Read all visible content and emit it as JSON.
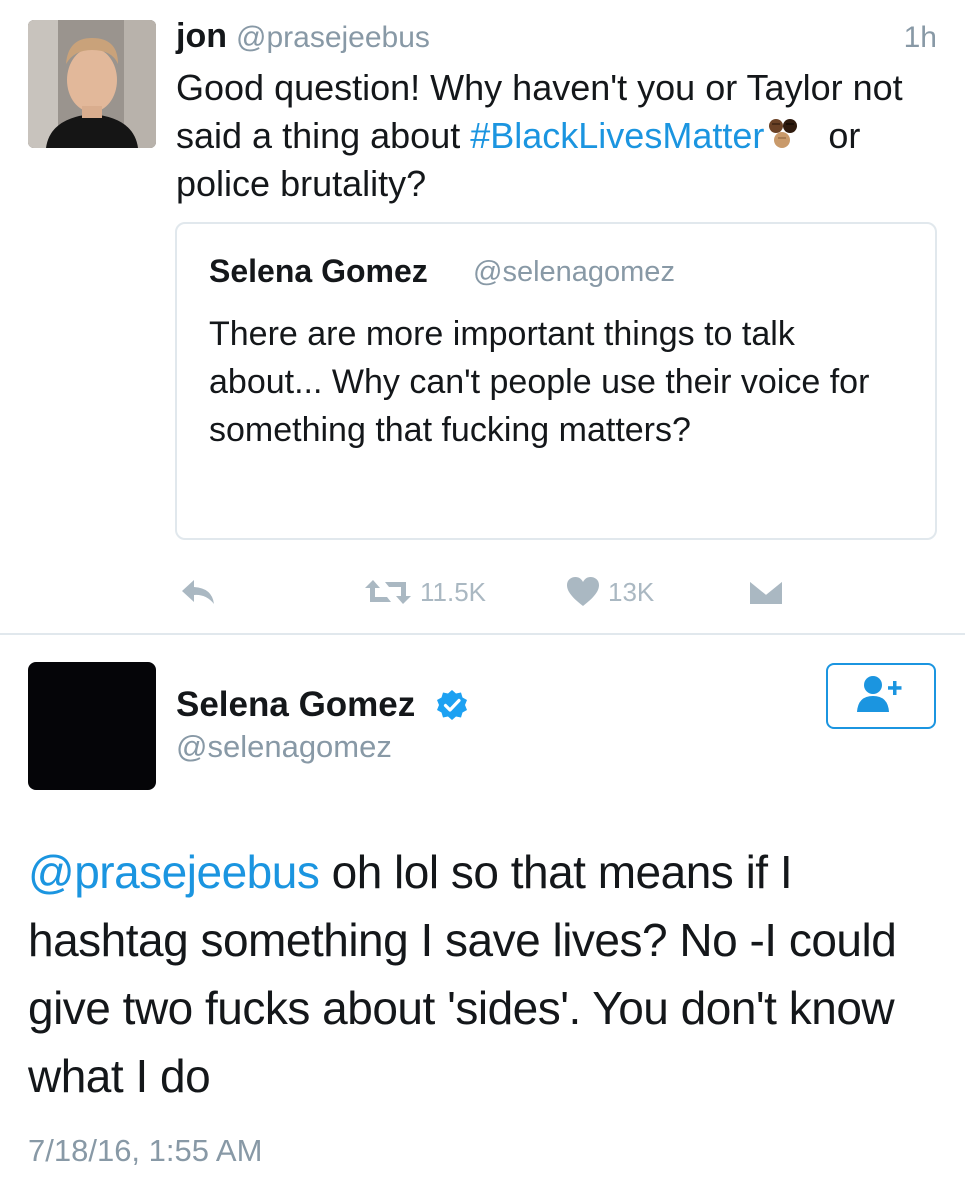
{
  "reply_tweet": {
    "author_name": "jon",
    "author_handle": "@prasejeebus",
    "time_ago": "1h",
    "text_before": "Good question! Why haven't you or Taylor not said a thing about ",
    "hashtag": "#BlackLivesMatter",
    "text_after": " or police brutality?",
    "emoji": "raised-fists-emoji",
    "quoted_tweet": {
      "author_name": "Selena Gomez",
      "author_handle": "@selenagomez",
      "text": "There are more important things to talk about... Why can't people use their voice for something that fucking matters?"
    },
    "actions": {
      "reply_icon": "reply-icon",
      "retweet_icon": "retweet-icon",
      "retweet_count": "11.5K",
      "like_icon": "heart-icon",
      "like_count": "13K",
      "dm_icon": "envelope-icon"
    }
  },
  "main_tweet": {
    "author_name": "Selena Gomez",
    "verified": true,
    "author_handle": "@selenagomez",
    "follow_icon": "add-user-icon",
    "mention": "@prasejeebus",
    "text": " oh lol so that means if I hashtag something I save lives? No -I could give two fucks about 'sides'. You don't know what I do",
    "timestamp": "7/18/16, 1:55 AM"
  },
  "colors": {
    "link": "#1b95e0",
    "secondary_text": "#8899a6",
    "icon_gray": "#aab8c2",
    "border": "#e1e8ed",
    "verified": "#1da1f2"
  }
}
